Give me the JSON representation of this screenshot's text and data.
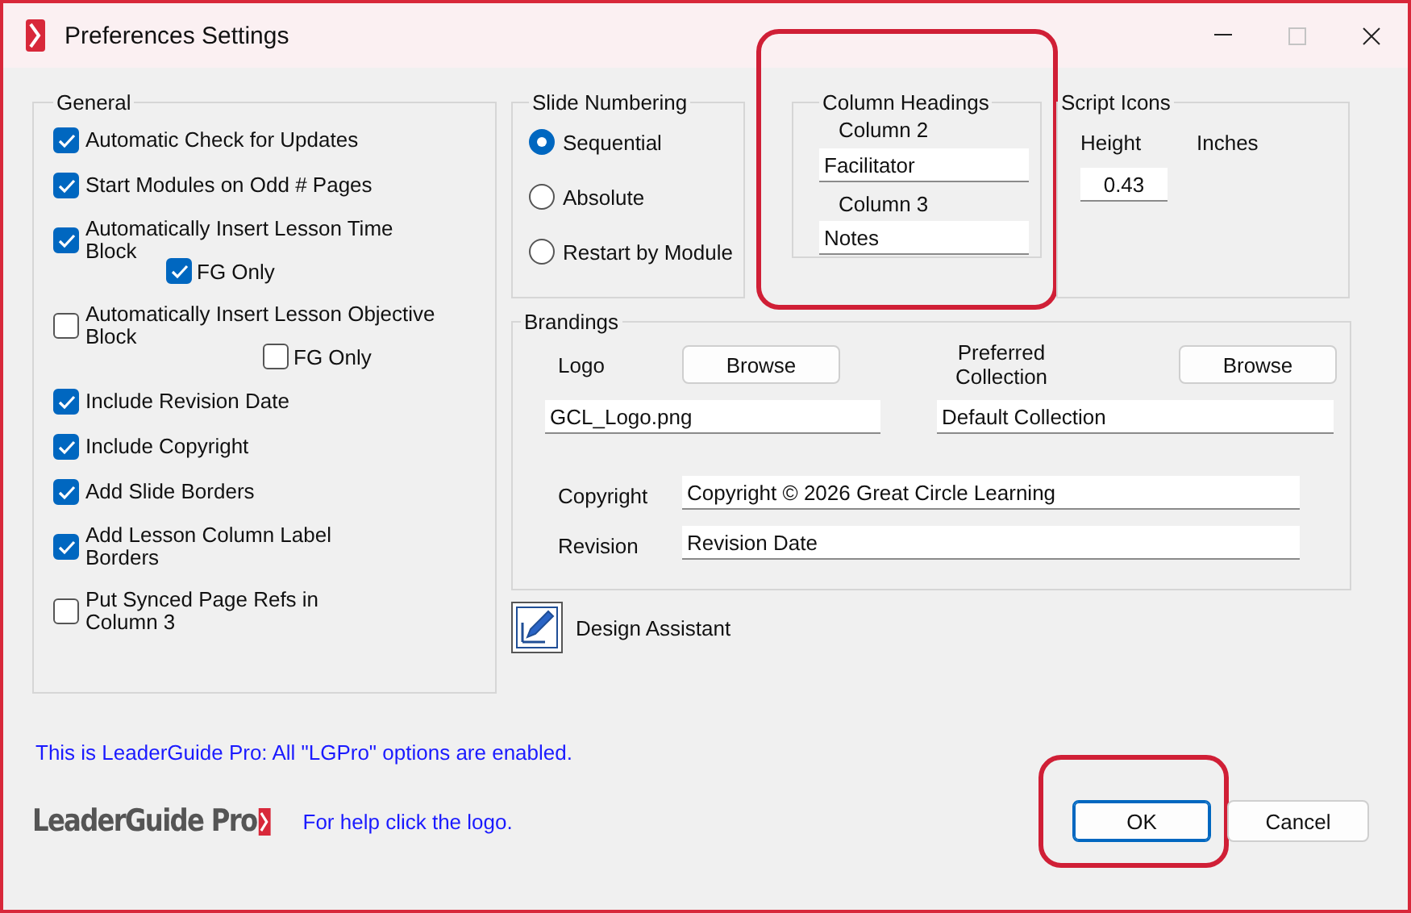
{
  "window": {
    "title": "Preferences Settings",
    "maximize_disabled": true
  },
  "general": {
    "title": "General",
    "options": [
      {
        "label": "Automatic Check for Updates",
        "checked": true
      },
      {
        "label": "Start Modules on Odd # Pages",
        "checked": true
      },
      {
        "label": "Automatically Insert Lesson Time Block",
        "checked": true,
        "fg_only": {
          "label": "FG Only",
          "checked": true
        }
      },
      {
        "label": "Automatically Insert Lesson Objective Block",
        "checked": false,
        "fg_only": {
          "label": "FG Only",
          "checked": false
        }
      },
      {
        "label": "Include Revision Date",
        "checked": true
      },
      {
        "label": "Include Copyright",
        "checked": true
      },
      {
        "label": "Add Slide Borders",
        "checked": true
      },
      {
        "label": "Add Lesson Column Label Borders",
        "checked": true
      },
      {
        "label": "Put Synced Page Refs in Column 3",
        "checked": false
      }
    ]
  },
  "slide_numbering": {
    "title": "Slide Numbering",
    "options": [
      {
        "label": "Sequential",
        "selected": true
      },
      {
        "label": "Absolute",
        "selected": false
      },
      {
        "label": "Restart by Module",
        "selected": false
      }
    ]
  },
  "column_headings": {
    "title": "Column Headings",
    "highlighted": true,
    "columns": [
      {
        "label": "Column 2",
        "value": "Facilitator"
      },
      {
        "label": "Column 3",
        "value": "Notes"
      }
    ]
  },
  "script_icons": {
    "title": "Script Icons",
    "height_label": "Height",
    "unit_label": "Inches",
    "value": "0.43"
  },
  "brandings": {
    "title": "Brandings",
    "logo_label": "Logo",
    "logo_browse": "Browse",
    "collection_label": "Preferred Collection",
    "collection_browse": "Browse",
    "logo_value": "GCL_Logo.png",
    "collection_value": "Default Collection",
    "copyright_label": "Copyright",
    "copyright_value": "Copyright © 2026 Great Circle Learning",
    "revision_label": "Revision",
    "revision_value": "Revision Date"
  },
  "design_assistant": {
    "label": "Design Assistant"
  },
  "note": "This is LeaderGuide Pro: All \"LGPro\" options are enabled.",
  "logo_text": "LeaderGuide Pro",
  "help_text": "For help click the logo.",
  "buttons": [
    {
      "label": "OK",
      "default": true,
      "highlighted": true
    },
    {
      "label": "Cancel",
      "default": false,
      "highlighted": false
    }
  ]
}
